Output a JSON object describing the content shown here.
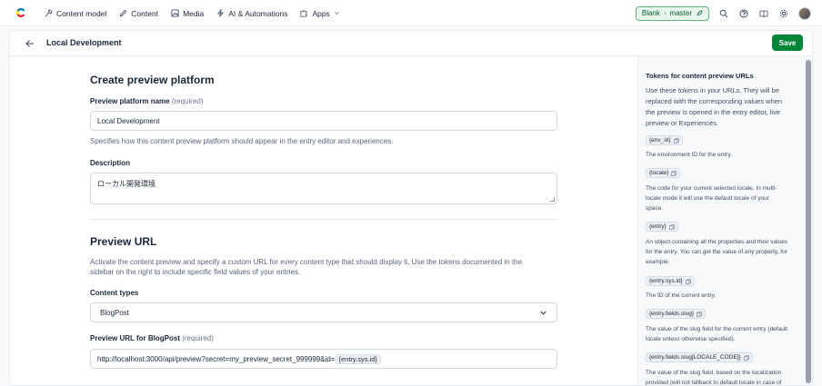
{
  "nav": {
    "items": [
      {
        "label": "Content model",
        "icon": "wrench-icon"
      },
      {
        "label": "Content",
        "icon": "pen-icon"
      },
      {
        "label": "Media",
        "icon": "image-icon"
      },
      {
        "label": "AI & Automations",
        "icon": "lightning-icon"
      },
      {
        "label": "Apps",
        "icon": "puzzle-icon"
      }
    ],
    "env": {
      "space": "Blank",
      "environment": "master"
    }
  },
  "header": {
    "title": "Local Development",
    "save_label": "Save"
  },
  "form": {
    "section1_title": "Create preview platform",
    "name_label": "Preview platform name",
    "required": "(required)",
    "name_value": "Local Development",
    "name_help": "Specifies how this content preview platform should appear in the entry editor and experiences.",
    "description_label": "Description",
    "description_value": "ローカル開発環境",
    "section2_title": "Preview URL",
    "section2_help_1": "Activate the content preview and specify a custom URL for every content type that should display it. Use the tokens documented in the",
    "section2_help_2": "sidebar on the right to include specific field values of your entries.",
    "content_types_label": "Content types",
    "content_type_value": "BlogPost",
    "url_label": "Preview URL for BlogPost",
    "url_value": "http://localhost:3000/api/preview?secret=my_preview_secret_999999&id=",
    "url_token": "{entry.sys.id}"
  },
  "sidebar": {
    "title": "Tokens for content preview URLs",
    "intro": [
      "Use these tokens in your URLs. They will be",
      "replaced with the corresponding values when",
      "the preview is opened in the entry editor, live",
      "preview or Experiences."
    ],
    "tokens": [
      {
        "token": "{env_id}",
        "desc": [
          "The environment ID for the entry."
        ]
      },
      {
        "token": "{locale}",
        "desc": [
          "The code for your current selected locale. In multi-",
          "locale mode it will use the default locale of your",
          "space."
        ]
      },
      {
        "token": "{entry}",
        "desc": [
          "An object containing all the properties and their values",
          "for the entry. You can get the value of any property, for",
          "example:"
        ]
      },
      {
        "token": "{entry.sys.id}",
        "desc": [
          "The ID of the current entry."
        ]
      },
      {
        "token": "{entry.fields.slug}",
        "desc": [
          "The value of the slug field for the current entry (default",
          "locale unless otherwise specified)."
        ]
      },
      {
        "token": "{entry.fields.slug[LOCALE_CODE]}",
        "desc": [
          "The value of the slug field, based on the localization",
          "provided (will not fallback to default locale in case of"
        ]
      }
    ]
  }
}
